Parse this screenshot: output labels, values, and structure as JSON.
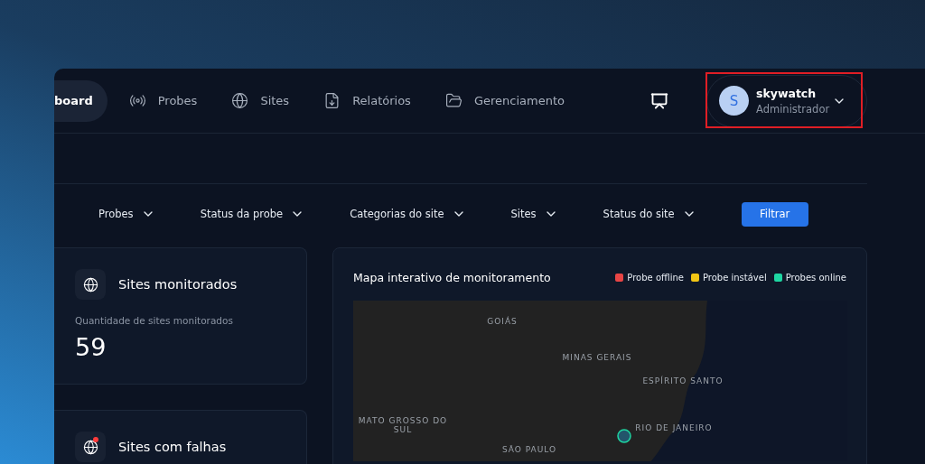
{
  "nav": {
    "items": [
      {
        "label": "board",
        "kind": "dashboard",
        "selected": true
      },
      {
        "label": "Probes",
        "kind": "probes",
        "selected": false
      },
      {
        "label": "Sites",
        "kind": "sites",
        "selected": false
      },
      {
        "label": "Relatórios",
        "kind": "reports",
        "selected": false
      },
      {
        "label": "Gerenciamento",
        "kind": "management",
        "selected": false
      }
    ]
  },
  "user": {
    "initial": "S",
    "name": "skywatch",
    "role": "Administrador",
    "highlighted": true
  },
  "filters": [
    {
      "label": "Probes"
    },
    {
      "label": "Status da probe"
    },
    {
      "label": "Categorias do site"
    },
    {
      "label": "Sites"
    },
    {
      "label": "Status do site"
    }
  ],
  "filter_button": "Filtrar",
  "cards": [
    {
      "title": "Sites monitorados",
      "subtitle": "Quantidade de sites monitorados",
      "value": "59",
      "alert": false
    },
    {
      "title": "Sites com falhas",
      "alert": true
    }
  ],
  "map": {
    "title": "Mapa interativo de monitoramento",
    "legend": [
      {
        "label": "Probe offline",
        "color": "#e84545"
      },
      {
        "label": "Probe instável",
        "color": "#f2c614"
      },
      {
        "label": "Probes online",
        "color": "#1ed6a2"
      }
    ],
    "labels": [
      "GOIÁS",
      "MINAS GERAIS",
      "ESPÍRITO SANTO",
      "MATO GROSSO DO SUL",
      "SÃO PAULO",
      "RIO DE JANEIRO"
    ]
  }
}
